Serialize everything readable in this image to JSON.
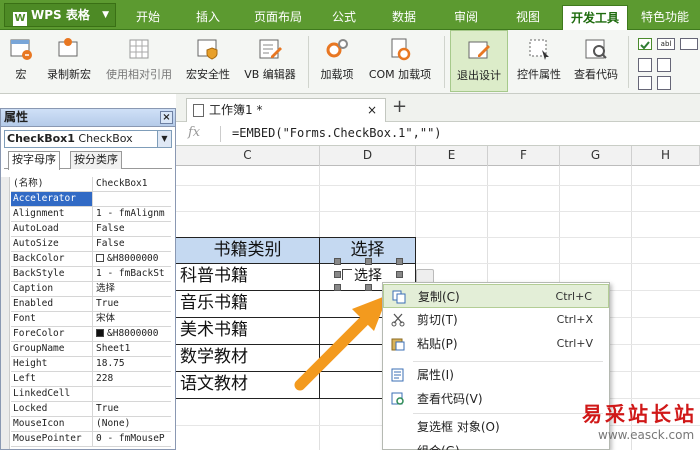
{
  "app": {
    "name": "WPS 表格",
    "logo": "W"
  },
  "ribbon_tabs": [
    "开始",
    "插入",
    "页面布局",
    "公式",
    "数据",
    "审阅",
    "视图",
    "开发工具",
    "特色功能"
  ],
  "active_tab": "开发工具",
  "ribbon": {
    "macro": "宏",
    "record_macro": "录制新宏",
    "relative_ref": "使用相对引用",
    "macro_security": "宏安全性",
    "vb_editor": "VB 编辑器",
    "addins": "加载项",
    "com_addins": "COM 加载项",
    "exit_design": "退出设计",
    "control_props": "控件属性",
    "view_code": "查看代码",
    "mini_text": "abl"
  },
  "props": {
    "title": "属性",
    "combo_name": "CheckBox1",
    "combo_type": "CheckBox",
    "tab_alpha": "按字母序",
    "tab_category": "按分类序",
    "rows": [
      {
        "name": "(名称)",
        "value": "CheckBox1"
      },
      {
        "name": "Accelerator",
        "value": ""
      },
      {
        "name": "Alignment",
        "value": "1 - fmAlignm"
      },
      {
        "name": "AutoLoad",
        "value": "False"
      },
      {
        "name": "AutoSize",
        "value": "False"
      },
      {
        "name": "BackColor",
        "value": "&H8000000"
      },
      {
        "name": "BackStyle",
        "value": "1 - fmBackSt"
      },
      {
        "name": "Caption",
        "value": "选择"
      },
      {
        "name": "Enabled",
        "value": "True"
      },
      {
        "name": "Font",
        "value": "宋体"
      },
      {
        "name": "ForeColor",
        "value": "&H8000000"
      },
      {
        "name": "GroupName",
        "value": "Sheet1"
      },
      {
        "name": "Height",
        "value": "18.75"
      },
      {
        "name": "Left",
        "value": "228"
      },
      {
        "name": "LinkedCell",
        "value": ""
      },
      {
        "name": "Locked",
        "value": "True"
      },
      {
        "name": "MouseIcon",
        "value": "(None)"
      },
      {
        "name": "MousePointer",
        "value": "0 - fmMouseP"
      }
    ],
    "selected_row": "Accelerator"
  },
  "document": {
    "tab_title": "工作簿1 *",
    "close": "×",
    "add": "+"
  },
  "formula": {
    "fx": "fx",
    "value": "=EMBED(\"Forms.CheckBox.1\",\"\")"
  },
  "columns": [
    "C",
    "D",
    "E",
    "F",
    "G",
    "H"
  ],
  "table": {
    "header": [
      "书籍类别",
      "选择"
    ],
    "rows": [
      "科普书籍",
      "音乐书籍",
      "美术书籍",
      "数学教材",
      "语文教材"
    ]
  },
  "checkbox": {
    "caption": "选择"
  },
  "context_menu": [
    {
      "label": "复制(C)",
      "shortcut": "Ctrl+C",
      "icon": "copy-icon",
      "highlighted": true
    },
    {
      "label": "剪切(T)",
      "shortcut": "Ctrl+X",
      "icon": "cut-icon"
    },
    {
      "label": "粘贴(P)",
      "shortcut": "Ctrl+V",
      "icon": "paste-icon"
    },
    {
      "label": "属性(I)",
      "shortcut": "",
      "icon": "properties-icon"
    },
    {
      "label": "查看代码(V)",
      "shortcut": "",
      "icon": "view-code-icon"
    },
    {
      "label": "复选框 对象(O)",
      "shortcut": "",
      "icon": ""
    },
    {
      "label": "组合(G)",
      "shortcut": "",
      "icon": ""
    }
  ],
  "watermark": {
    "title": "易采站长站",
    "url": "www.easck.com"
  },
  "colors": {
    "ribbon_green": "#5c9a30",
    "header_fill": "#c5d9f1",
    "arrow": "#f39a1e",
    "selection": "#316ac5",
    "watermark_red": "#d01818"
  }
}
